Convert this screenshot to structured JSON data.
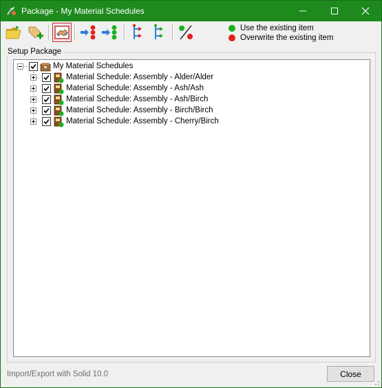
{
  "window": {
    "title": "Package - My Material Schedules",
    "titlebar_color": "#1e8a1e",
    "controls": [
      "minimize-icon",
      "maximize-icon",
      "close-icon"
    ]
  },
  "toolbar": {
    "buttons": [
      {
        "name": "open-folder-button",
        "icon": "open-folder-icon"
      },
      {
        "name": "add-tag-button",
        "icon": "tag-add-icon"
      },
      {
        "name": "handshake-button",
        "icon": "handshake-icon",
        "selected": true
      },
      {
        "name": "move-to-red-stack-button",
        "icon": "arrow-red-stack-icon"
      },
      {
        "name": "move-to-green-stack-button",
        "icon": "arrow-green-stack-icon"
      },
      {
        "name": "red-branch-button",
        "icon": "red-branch-icon"
      },
      {
        "name": "green-branch-button",
        "icon": "green-branch-icon"
      },
      {
        "name": "toggle-status-button",
        "icon": "percent-dots-icon"
      }
    ]
  },
  "legend": [
    {
      "label": "Use the existing item",
      "color": "#1fae1f"
    },
    {
      "label": "Overwrite the existing item",
      "color": "#e02020"
    }
  ],
  "setup": {
    "group_label": "Setup Package",
    "root": {
      "label": "My Material Schedules",
      "checked": true,
      "expanded": true
    },
    "items": [
      {
        "label": "Material Schedule: Assembly - Alder/Alder",
        "checked": true,
        "status": "use-existing"
      },
      {
        "label": "Material Schedule: Assembly - Ash/Ash",
        "checked": true,
        "status": "use-existing"
      },
      {
        "label": "Material Schedule: Assembly - Ash/Birch",
        "checked": true,
        "status": "use-existing"
      },
      {
        "label": "Material Schedule: Assembly - Birch/Birch",
        "checked": true,
        "status": "use-existing"
      },
      {
        "label": "Material Schedule: Assembly - Cherry/Birch",
        "checked": true,
        "status": "use-existing"
      }
    ]
  },
  "footer": {
    "status_text": "Import/Export with Solid 10.0",
    "close_label": "Close"
  }
}
